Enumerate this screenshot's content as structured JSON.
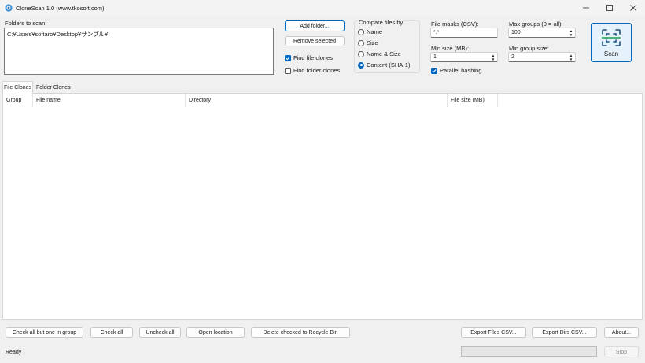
{
  "window": {
    "title": "CloneScan 1.0 (www.tkosoft.com)"
  },
  "folders": {
    "label": "Folders to scan:",
    "items": [
      "C:¥Users¥softaro¥Desktop¥サンプル¥"
    ]
  },
  "actions": {
    "add_folder": "Add folder...",
    "remove_selected": "Remove selected"
  },
  "options": {
    "find_file_clones": {
      "label": "Find file clones",
      "checked": true
    },
    "find_folder_clones": {
      "label": "Find folder clones",
      "checked": false
    },
    "parallel_hashing": {
      "label": "Parallel hashing",
      "checked": true
    }
  },
  "compare": {
    "label": "Compare files by",
    "options": [
      "Name",
      "Size",
      "Name & Size",
      "Content (SHA-1)"
    ],
    "selected": "Content (SHA-1)"
  },
  "fields": {
    "file_masks": {
      "label": "File masks (CSV):",
      "value": "*.*"
    },
    "min_size": {
      "label": "Min size (MB):",
      "value": "1"
    },
    "max_groups": {
      "label": "Max groups (0 = all):",
      "value": "100"
    },
    "min_group_size": {
      "label": "Min group size:",
      "value": "2"
    }
  },
  "scan": {
    "label": "Scan"
  },
  "tabs": [
    {
      "label": "File Clones",
      "active": true
    },
    {
      "label": "Folder Clones",
      "active": false
    }
  ],
  "table": {
    "columns": [
      "Group",
      "File name",
      "Directory",
      "File size (MB)"
    ],
    "rows": []
  },
  "bottom_buttons": {
    "check_all_but_one": "Check all but one in group",
    "check_all": "Check all",
    "uncheck_all": "Uncheck all",
    "open_location": "Open location",
    "delete_checked": "Delete checked to Recycle Bin",
    "export_files": "Export Files CSV...",
    "export_dirs": "Export Dirs CSV...",
    "about": "About..."
  },
  "status": {
    "text": "Ready",
    "progress": 0,
    "stop_label": "Stop"
  },
  "colors": {
    "accent": "#0067c0",
    "window_bg": "#f0f0f0"
  }
}
